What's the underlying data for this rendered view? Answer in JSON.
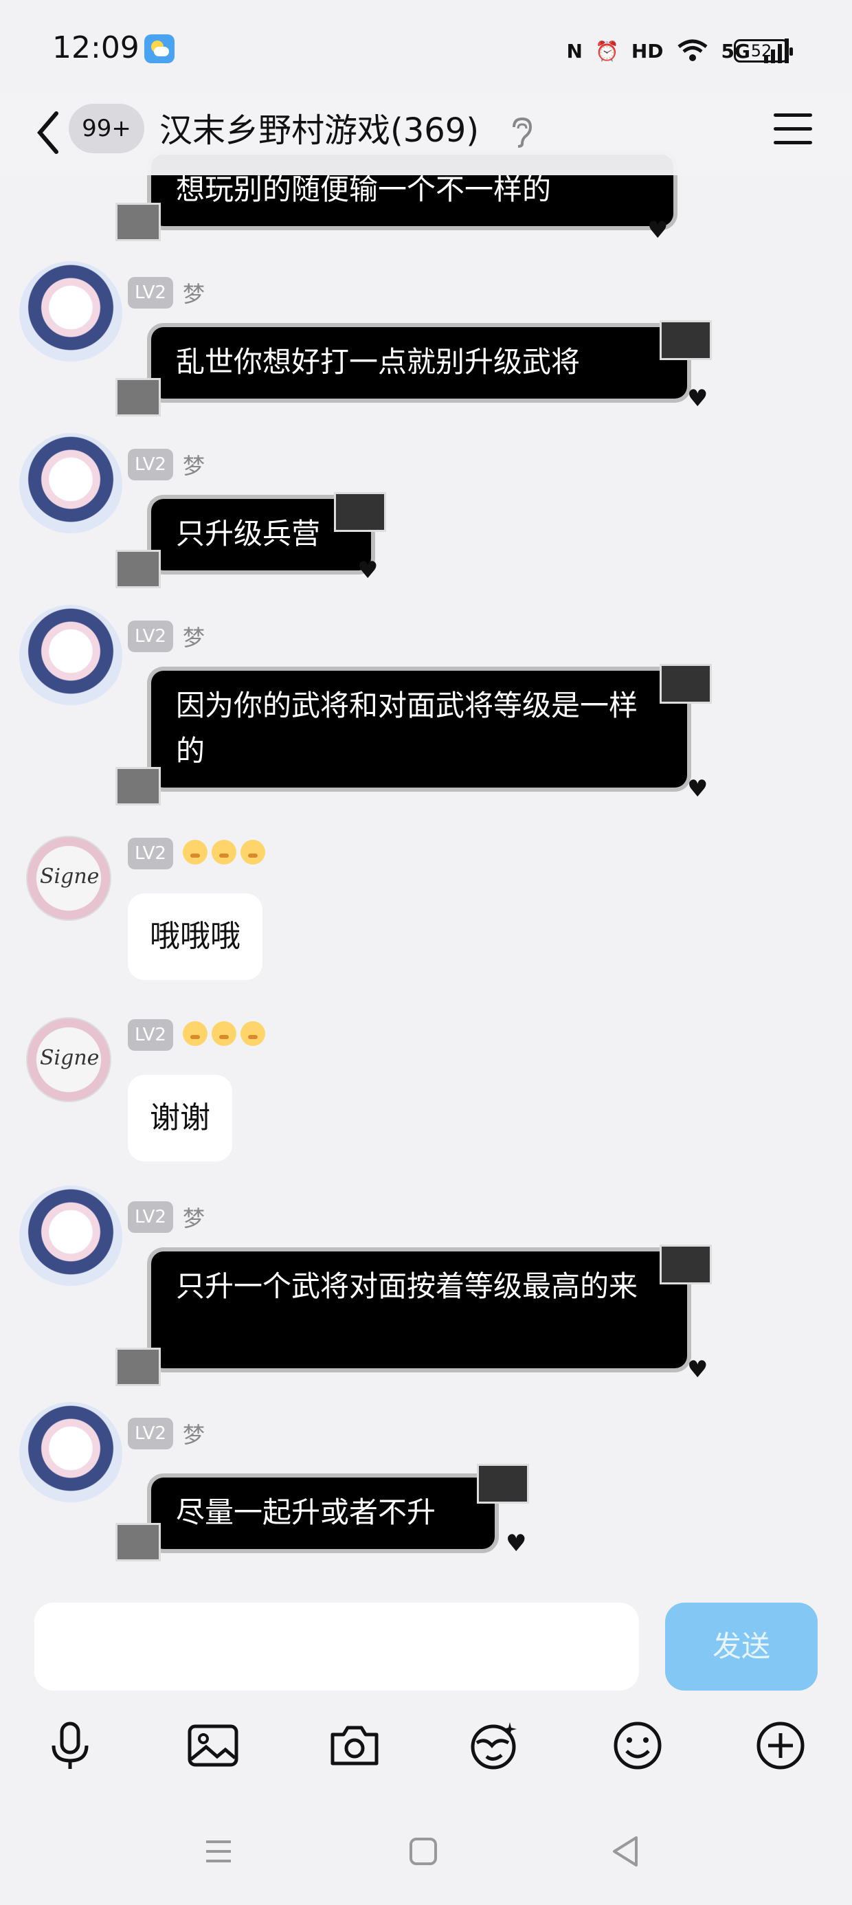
{
  "status_bar": {
    "time": "12:09",
    "battery": "52",
    "icons": [
      "nfc-icon",
      "alarm-icon",
      "hd-icon",
      "wifi-icon",
      "5g-signal-icon"
    ],
    "signal_labels": [
      "N",
      "⏰",
      "HD",
      "5G"
    ]
  },
  "header": {
    "unread_badge": "99+",
    "title": "汉末乡野村游戏(369)"
  },
  "messages": [
    {
      "type": "dark",
      "lv": "LV2",
      "nick": "梦",
      "text": "想玩别的随便输一个不一样的"
    },
    {
      "type": "dark",
      "lv": "LV2",
      "nick": "梦",
      "text": "乱世你想好打一点就别升级武将"
    },
    {
      "type": "dark",
      "lv": "LV2",
      "nick": "梦",
      "text": "只升级兵营"
    },
    {
      "type": "dark",
      "lv": "LV2",
      "nick": "梦",
      "text": "因为你的武将和对面武将等级是一样的"
    },
    {
      "type": "white",
      "lv": "LV2",
      "nick": "",
      "text": "哦哦哦"
    },
    {
      "type": "white",
      "lv": "LV2",
      "nick": "",
      "text": "谢谢"
    },
    {
      "type": "dark",
      "lv": "LV2",
      "nick": "梦",
      "text": "只升一个武将对面按着等级最高的来"
    },
    {
      "type": "dark",
      "lv": "LV2",
      "nick": "梦",
      "text": "尽量一起升或者不升"
    }
  ],
  "composer": {
    "input_value": "",
    "send_label": "发送"
  },
  "toolbar": [
    "microphone-icon",
    "image-icon",
    "camera-icon",
    "sticker-icon",
    "emoji-icon",
    "plus-icon"
  ],
  "colors": {
    "background": "#f2f2f5",
    "send_button": "#83c8f5",
    "bubble_dark": "#000000",
    "bubble_white": "#ffffff"
  }
}
